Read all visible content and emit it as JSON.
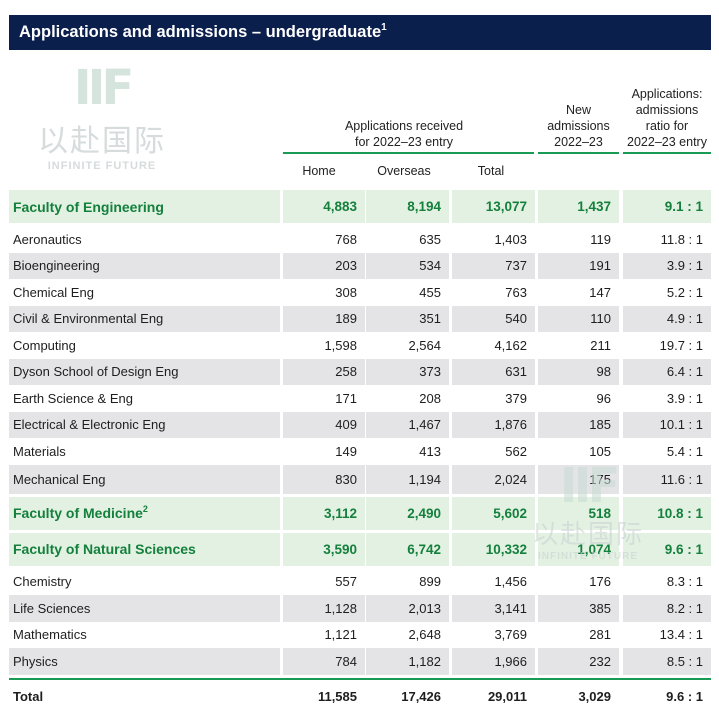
{
  "title": "Applications and admissions – undergraduate",
  "title_sup": "1",
  "headers": {
    "applications_group_line1": "Applications received",
    "applications_group_line2": "for 2022–23 entry",
    "home": "Home",
    "overseas": "Overseas",
    "total": "Total",
    "new_line1": "New",
    "new_line2": "admissions",
    "new_line3": "2022–23",
    "ratio_line1": "Applications:",
    "ratio_line2": "admissions",
    "ratio_line3": "ratio for",
    "ratio_line4": "2022–23 entry"
  },
  "watermark": {
    "logo": "IIF",
    "chinese": "以赴国际",
    "english": "INFINITE FUTURE"
  },
  "rows": [
    {
      "name": "Faculty of Engineering",
      "sup": "",
      "home": "4,883",
      "overseas": "8,194",
      "total": "13,077",
      "new": "1,437",
      "ratio": "9.1 : 1"
    },
    {
      "name": "Aeronautics",
      "home": "768",
      "overseas": "635",
      "total": "1,403",
      "new": "119",
      "ratio": "11.8 : 1"
    },
    {
      "name": "Bioengineering",
      "home": "203",
      "overseas": "534",
      "total": "737",
      "new": "191",
      "ratio": "3.9 : 1"
    },
    {
      "name": "Chemical Eng",
      "home": "308",
      "overseas": "455",
      "total": "763",
      "new": "147",
      "ratio": "5.2 : 1"
    },
    {
      "name": "Civil & Environmental Eng",
      "home": "189",
      "overseas": "351",
      "total": "540",
      "new": "110",
      "ratio": "4.9 : 1"
    },
    {
      "name": "Computing",
      "home": "1,598",
      "overseas": "2,564",
      "total": "4,162",
      "new": "211",
      "ratio": "19.7 : 1"
    },
    {
      "name": "Dyson School of Design Eng",
      "home": "258",
      "overseas": "373",
      "total": "631",
      "new": "98",
      "ratio": "6.4 : 1"
    },
    {
      "name": "Earth Science & Eng",
      "home": "171",
      "overseas": "208",
      "total": "379",
      "new": "96",
      "ratio": "3.9 : 1"
    },
    {
      "name": "Electrical & Electronic Eng",
      "home": "409",
      "overseas": "1,467",
      "total": "1,876",
      "new": "185",
      "ratio": "10.1 : 1"
    },
    {
      "name": "Materials",
      "home": "149",
      "overseas": "413",
      "total": "562",
      "new": "105",
      "ratio": "5.4 : 1"
    },
    {
      "name": "Mechanical Eng",
      "home": "830",
      "overseas": "1,194",
      "total": "2,024",
      "new": "175",
      "ratio": "11.6 : 1"
    },
    {
      "name": "Faculty of Medicine",
      "sup": "2",
      "home": "3,112",
      "overseas": "2,490",
      "total": "5,602",
      "new": "518",
      "ratio": "10.8 : 1"
    },
    {
      "name": "Faculty of Natural Sciences",
      "sup": "",
      "home": "3,590",
      "overseas": "6,742",
      "total": "10,332",
      "new": "1,074",
      "ratio": "9.6 : 1"
    },
    {
      "name": "Chemistry",
      "home": "557",
      "overseas": "899",
      "total": "1,456",
      "new": "176",
      "ratio": "8.3 : 1"
    },
    {
      "name": "Life Sciences",
      "home": "1,128",
      "overseas": "2,013",
      "total": "3,141",
      "new": "385",
      "ratio": "8.2 : 1"
    },
    {
      "name": "Mathematics",
      "home": "1,121",
      "overseas": "2,648",
      "total": "3,769",
      "new": "281",
      "ratio": "13.4 : 1"
    },
    {
      "name": "Physics",
      "home": "784",
      "overseas": "1,182",
      "total": "1,966",
      "new": "232",
      "ratio": "8.5 : 1"
    }
  ],
  "total_row": {
    "name": "Total",
    "home": "11,585",
    "overseas": "17,426",
    "total": "29,011",
    "new": "3,029",
    "ratio": "9.6 : 1"
  },
  "colors": {
    "title_bg": "#0b1f4d",
    "faculty_bg": "#e3f1e3",
    "faculty_text": "#14803c",
    "grey_row": "#e4e4e7",
    "rule": "#1a9b55"
  }
}
